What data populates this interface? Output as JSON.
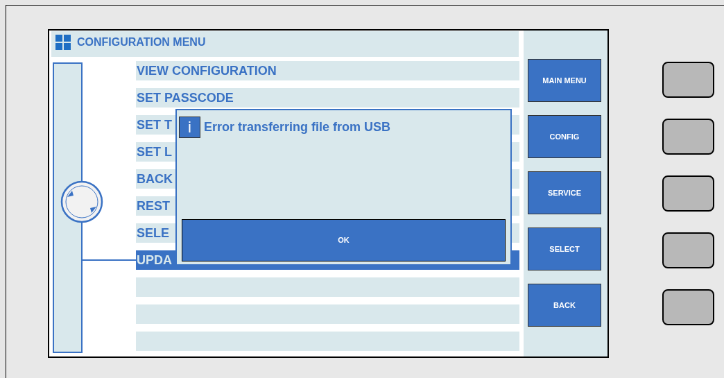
{
  "screen_title": "CONFIGURATION MENU",
  "menu": {
    "items": [
      {
        "label": "VIEW CONFIGURATION",
        "selected": false
      },
      {
        "label": "SET PASSCODE",
        "selected": false
      },
      {
        "label": "SET T",
        "selected": false
      },
      {
        "label": "SET L",
        "selected": false
      },
      {
        "label": "BACK",
        "selected": false
      },
      {
        "label": "REST",
        "selected": false
      },
      {
        "label": "SELE",
        "selected": false
      },
      {
        "label": "UPDA",
        "selected": true
      },
      {
        "selected": false
      },
      {
        "selected": false
      },
      {
        "selected": false
      }
    ]
  },
  "side_buttons": [
    "MAIN MENU",
    "CONFIG",
    "SERVICE",
    "SELECT",
    "BACK"
  ],
  "dialog": {
    "icon": "i",
    "message": "Error transferring file from USB",
    "button": "OK"
  }
}
